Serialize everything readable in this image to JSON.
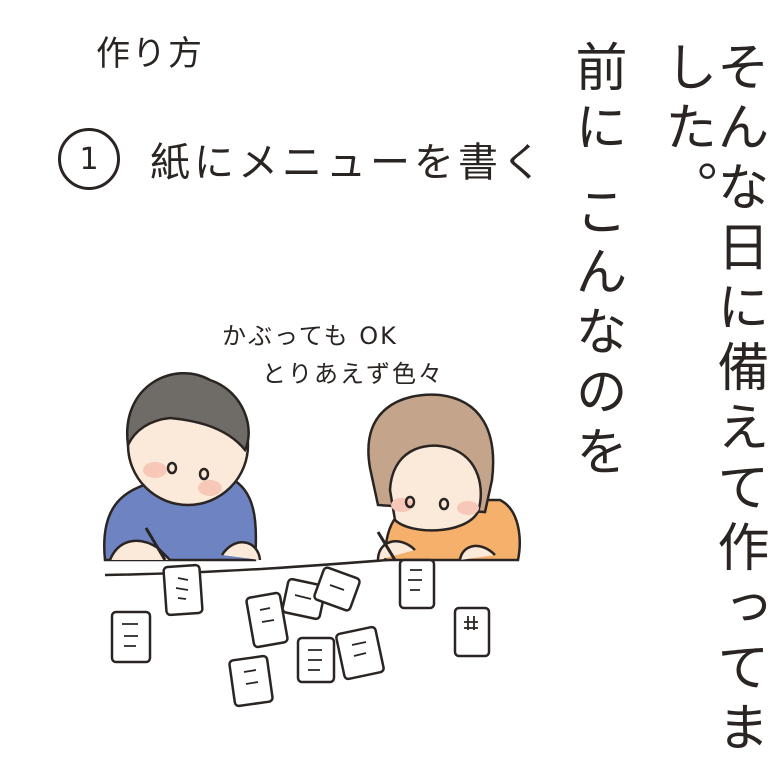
{
  "page": {
    "title": "作り方",
    "step": {
      "number": "1",
      "text": "紙にメニューを書く"
    },
    "narration": {
      "line1": "そんな日に備えて作ってました。",
      "line2": "前に こんなのを"
    },
    "note": {
      "line1": "かぶっても OK",
      "line2": "とりあえず色々"
    },
    "colors": {
      "boy_shirt": "#6e83c2",
      "girl_shirt": "#f5b06b",
      "boy_hair": "#6f6b67",
      "girl_hair": "#c4a48a",
      "skin": "#fbe9da",
      "cheek": "#f7c8b7",
      "line": "#2a2522"
    }
  }
}
